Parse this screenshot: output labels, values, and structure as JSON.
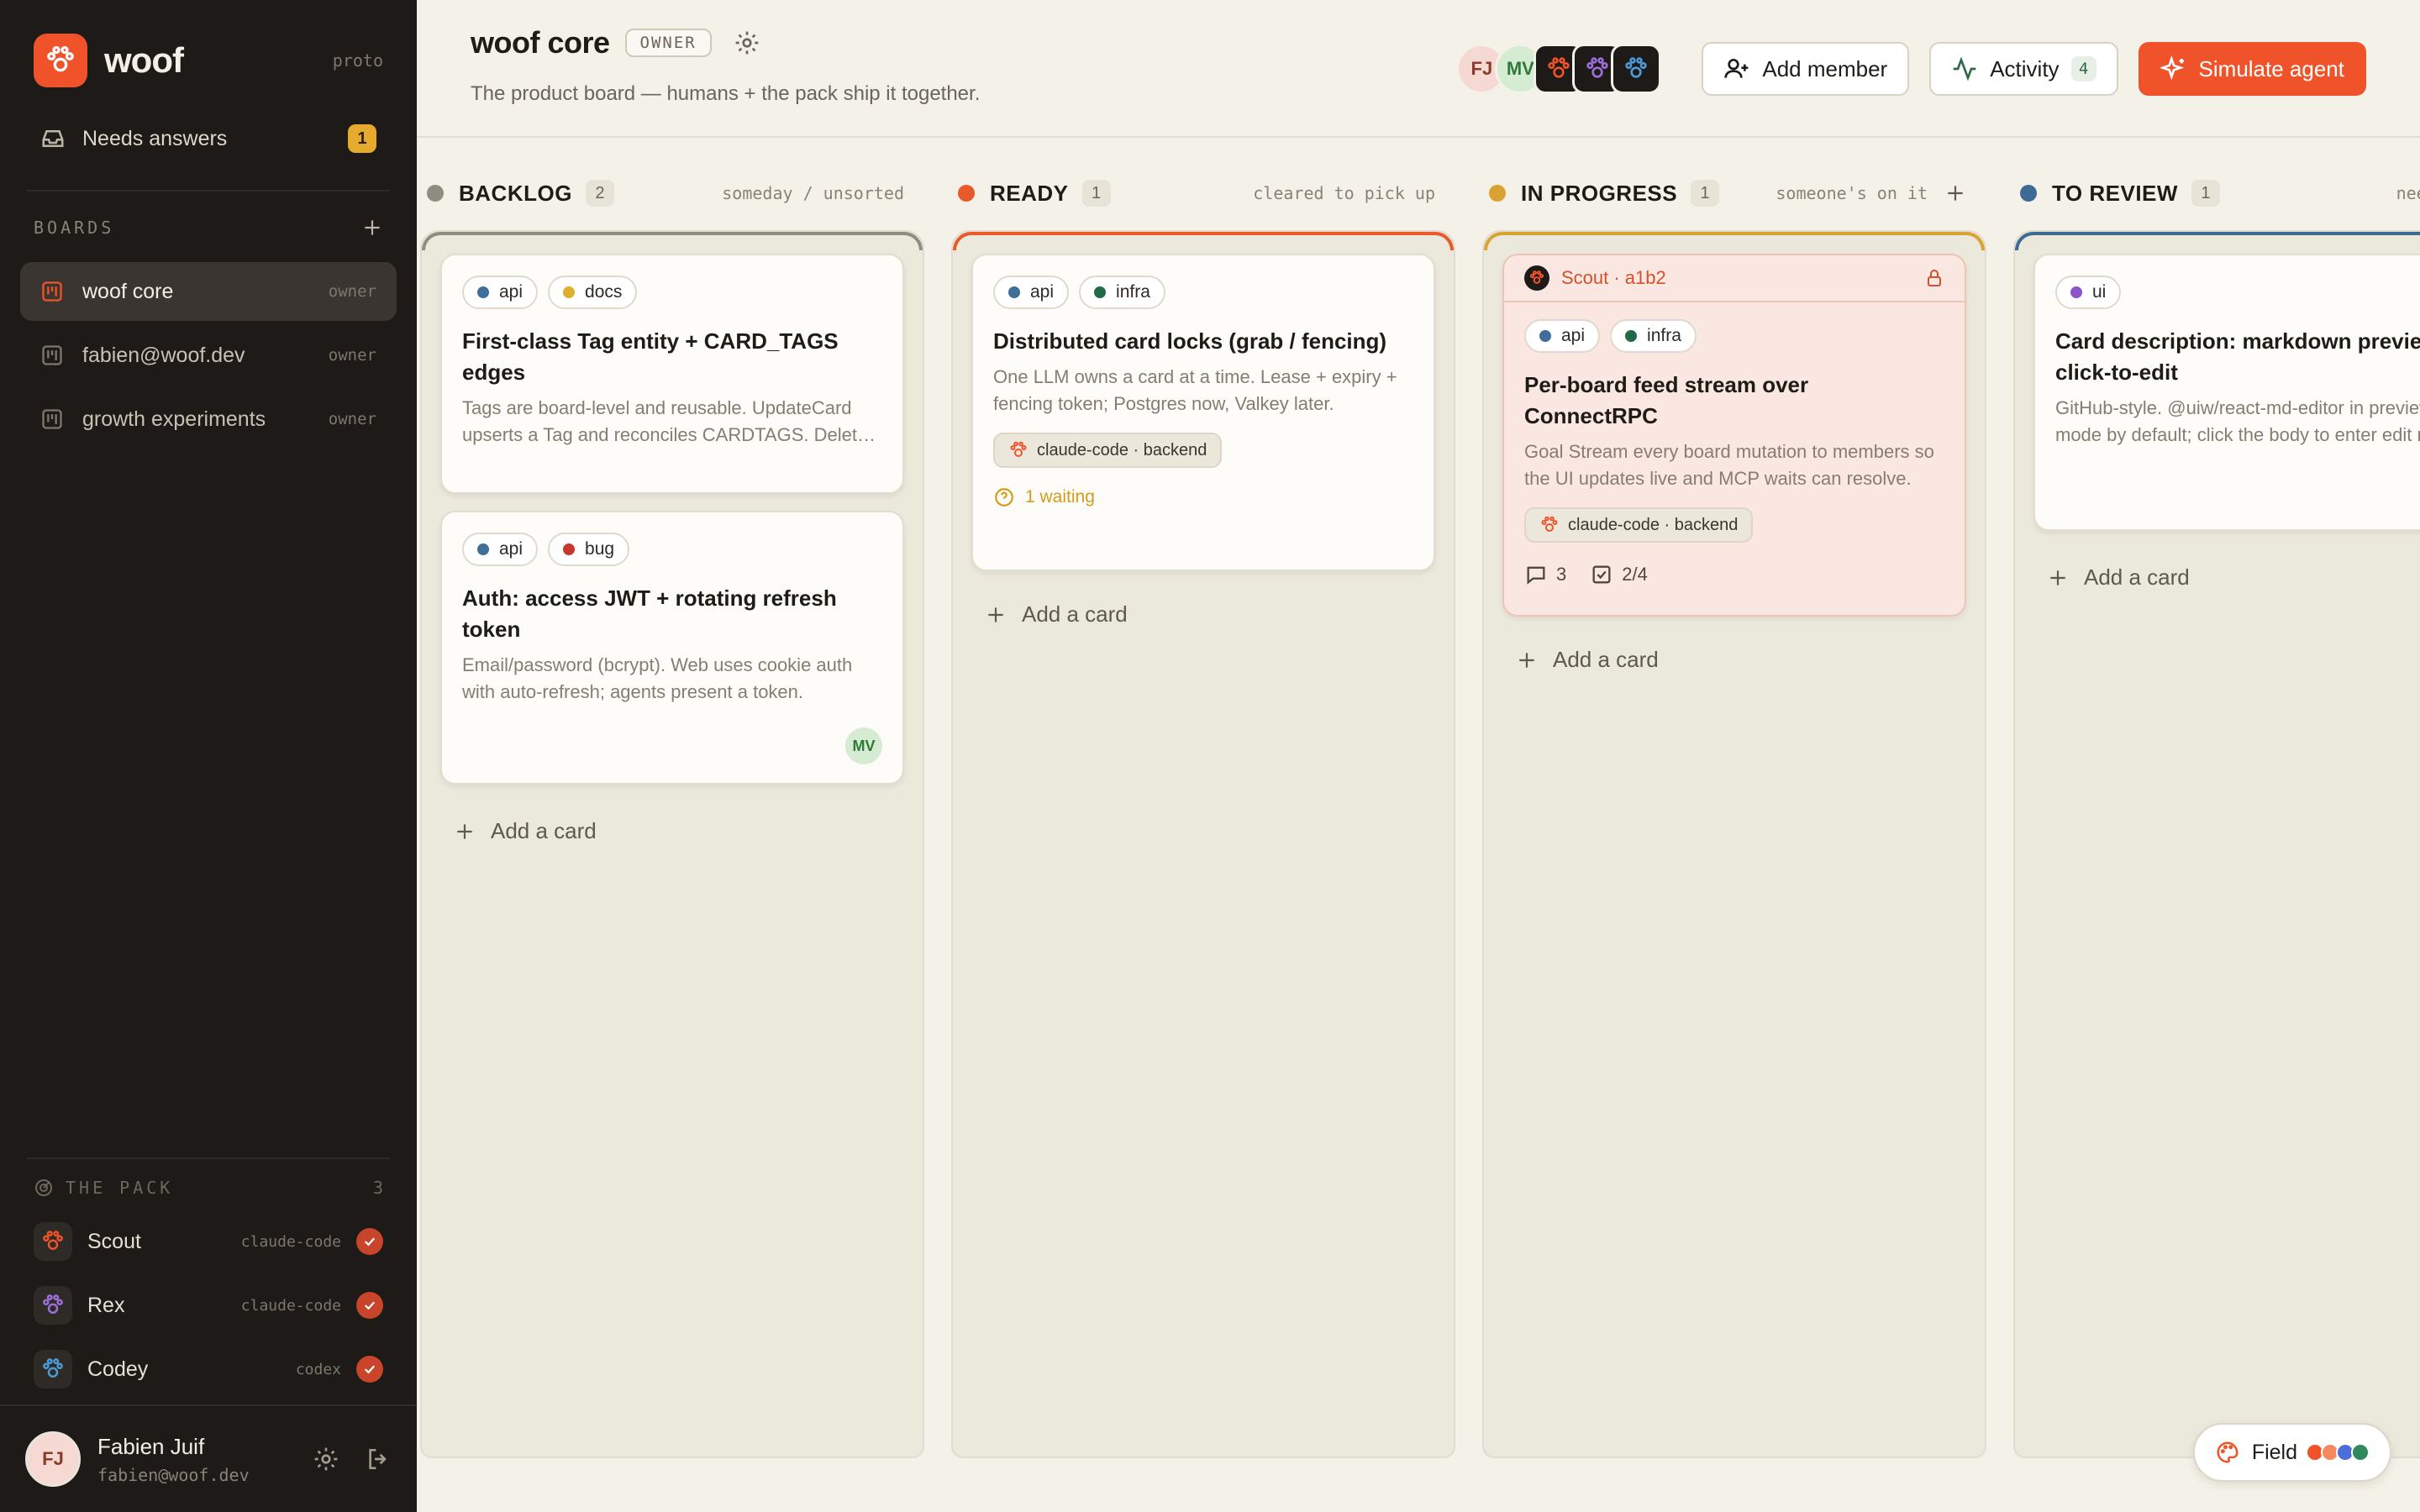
{
  "app": {
    "name": "woof",
    "env": "proto",
    "accent": "#f0532a"
  },
  "sidebar": {
    "needs_answers": {
      "label": "Needs answers",
      "count": "1",
      "icon": "inbox-icon"
    },
    "boards_label": "BOARDS",
    "boards": [
      {
        "name": "woof core",
        "role": "owner",
        "active": true
      },
      {
        "name": "fabien@woof.dev",
        "role": "owner",
        "active": false
      },
      {
        "name": "growth experiments",
        "role": "owner",
        "active": false
      }
    ],
    "pack_label": "THE PACK",
    "pack_count": "3",
    "pack": [
      {
        "name": "Scout",
        "engine": "claude-code",
        "color": "#f0532a"
      },
      {
        "name": "Rex",
        "engine": "claude-code",
        "color": "#9b6fd8"
      },
      {
        "name": "Codey",
        "engine": "codex",
        "color": "#4a9bd8"
      }
    ],
    "user": {
      "initials": "FJ",
      "name": "Fabien Juif",
      "email": "fabien@woof.dev"
    }
  },
  "header": {
    "title": "woof core",
    "role_pill": "OWNER",
    "subtitle": "The product board — humans + the pack ship it together.",
    "members": [
      "FJ",
      "MV"
    ],
    "add_member_label": "Add member",
    "activity_label": "Activity",
    "activity_count": "4",
    "simulate_label": "Simulate agent"
  },
  "columns": [
    {
      "name": "BACKLOG",
      "count": "2",
      "hint": "someday / unsorted",
      "color": "#8f8c80",
      "add_label": "Add a card",
      "cards": [
        {
          "tags": [
            {
              "label": "api",
              "color": "#3f6f99"
            },
            {
              "label": "docs",
              "color": "#e0ad2e"
            }
          ],
          "title": "First-class Tag entity + CARD_TAGS edges",
          "desc": "Tags are board-level and reusable. UpdateCard upserts a Tag and reconciles CARDTAGS. Delete-tag cascades edges."
        },
        {
          "tags": [
            {
              "label": "api",
              "color": "#3f6f99"
            },
            {
              "label": "bug",
              "color": "#c8372a"
            }
          ],
          "title": "Auth: access JWT + rotating refresh token",
          "desc": "Email/password (bcrypt). Web uses cookie auth with auto-refresh; agents present a token.",
          "assignee": "MV"
        }
      ]
    },
    {
      "name": "READY",
      "count": "1",
      "hint": "cleared to pick up",
      "color": "#e85a2a",
      "add_label": "Add a card",
      "cards": [
        {
          "tags": [
            {
              "label": "api",
              "color": "#3f6f99"
            },
            {
              "label": "infra",
              "color": "#1f6b47"
            }
          ],
          "title": "Distributed card locks (grab / fencing)",
          "desc": "One LLM owns a card at a time. Lease + expiry + fencing token; Postgres now, Valkey later.",
          "agent_chip": "claude-code · backend",
          "waiting": "1 waiting"
        }
      ]
    },
    {
      "name": "IN PROGRESS",
      "count": "1",
      "hint": "someone's on it",
      "color": "#d9a232",
      "add_label": "Add a card",
      "cards": [
        {
          "lock": "Scout · a1b2",
          "tags": [
            {
              "label": "api",
              "color": "#3f6f99"
            },
            {
              "label": "infra",
              "color": "#1f6b47"
            }
          ],
          "title": "Per-board feed stream over ConnectRPC",
          "desc": "Goal Stream every board mutation to members so the UI updates live and MCP waits can resolve.",
          "agent_chip": "claude-code · backend",
          "comments": "3",
          "checklist": "2/4"
        }
      ]
    },
    {
      "name": "TO REVIEW",
      "count": "1",
      "hint": "needs eyes",
      "color": "#3e6a96",
      "add_label": "Add a card",
      "cards": [
        {
          "tags": [
            {
              "label": "ui",
              "color": "#8f53c9"
            }
          ],
          "title": "Card description: markdown preview → click-to-edit",
          "desc": "GitHub-style. @uiw/react-md-editor in preview mode by default; click the body to enter edit mode."
        }
      ]
    }
  ],
  "theme": {
    "label": "Field",
    "swatches": [
      "#f0532a",
      "#f58a5f",
      "#4a6fd8",
      "#2e8a5a"
    ]
  }
}
